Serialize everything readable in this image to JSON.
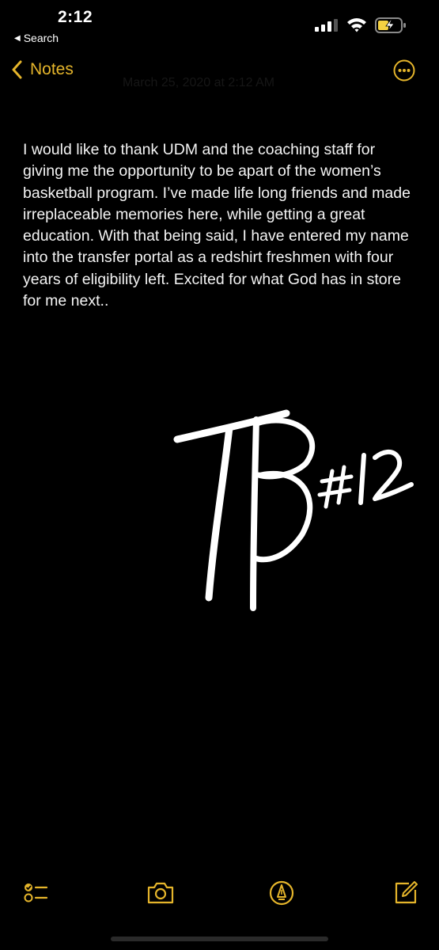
{
  "status_bar": {
    "time": "2:12",
    "back_app_label": "Search",
    "signal_icon": "cellular-signal-icon",
    "wifi_icon": "wifi-icon",
    "battery_icon": "battery-charging-icon",
    "battery_color": "#f5d142"
  },
  "nav": {
    "back_label": "Notes",
    "accent_color": "#e5b52b",
    "more_icon": "ellipsis-circle-icon",
    "date_text": "March 25, 2020 at 2:12 AM"
  },
  "note": {
    "body": "I would like to thank UDM and the coaching staff for giving me the opportunity to be apart of the women’s basketball program. I’ve made life long friends and made irreplaceable memories here, while getting a great education. With that being said, I have entered my name into the transfer portal as a redshirt freshmen with four years of eligibility left. Excited for what God has in store for me next..",
    "signature_text": "TB#12"
  },
  "toolbar": {
    "items": [
      {
        "icon": "checklist-icon"
      },
      {
        "icon": "camera-icon"
      },
      {
        "icon": "markup-pen-icon"
      },
      {
        "icon": "compose-icon"
      }
    ]
  }
}
